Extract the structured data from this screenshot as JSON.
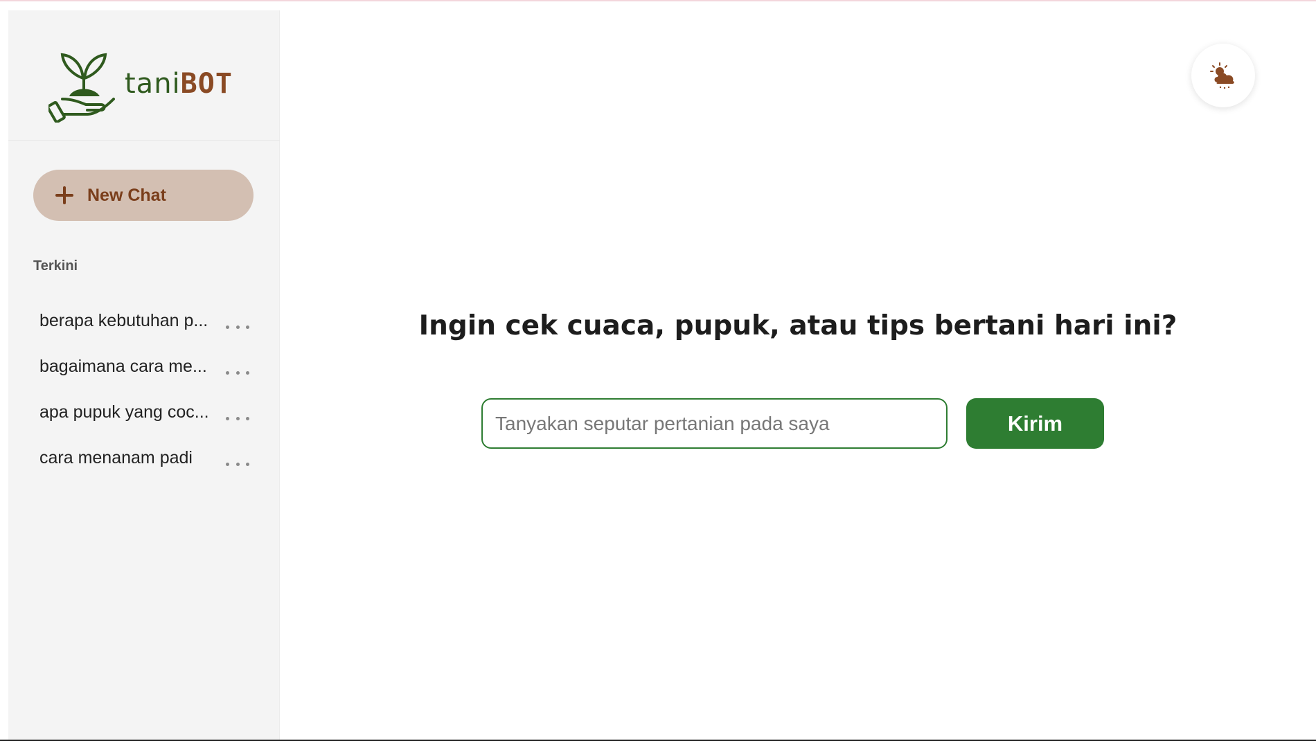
{
  "brand": {
    "name_part1": "tani",
    "name_part2": "BOT"
  },
  "sidebar": {
    "new_chat_label": "New Chat",
    "section_label": "Terkini",
    "history": [
      {
        "label": "berapa kebutuhan p..."
      },
      {
        "label": "bagaimana cara me..."
      },
      {
        "label": "apa pupuk yang coc..."
      },
      {
        "label": "cara menanam padi"
      }
    ]
  },
  "main": {
    "headline": "Ingin cek cuaca, pupuk, atau tips bertani hari ini?",
    "input_placeholder": "Tanyakan seputar pertanian pada saya",
    "input_value": "",
    "send_label": "Kirim"
  },
  "icons": {
    "logo": "plant-in-hand-icon",
    "new_chat": "plus-icon",
    "history_menu": "more-dots-icon",
    "weather": "weather-sun-cloud-icon"
  },
  "colors": {
    "primary_green": "#2e7d32",
    "brand_brown": "#7a3e1b",
    "new_chat_bg": "#d3bfb2",
    "sidebar_bg": "#f4f4f4"
  }
}
